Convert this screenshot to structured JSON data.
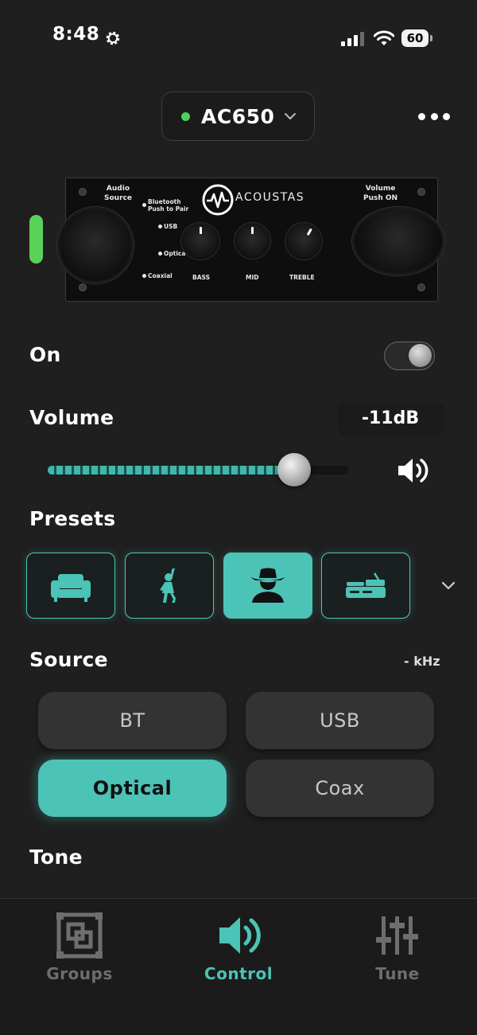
{
  "status_bar": {
    "time": "8:48",
    "battery": "60"
  },
  "header": {
    "device_name": "AC650"
  },
  "panel": {
    "brand": "ACOUSTAS",
    "audio_source_label": "Audio\nSource",
    "volume_label": "Volume\nPush ON",
    "bluetooth_label": "Bluetooth\nPush to Pair",
    "usb_label": "USB",
    "optical_label": "Optical",
    "coaxial_label": "Coaxial",
    "bass_label": "BASS",
    "mid_label": "MID",
    "treble_label": "TREBLE"
  },
  "power": {
    "label": "On",
    "value": true
  },
  "volume": {
    "label": "Volume",
    "readout": "-11dB",
    "level": 0.82
  },
  "presets": {
    "label": "Presets",
    "items": [
      {
        "icon": "couch-icon",
        "active": false
      },
      {
        "icon": "dancer-icon",
        "active": false
      },
      {
        "icon": "cowboy-icon",
        "active": true
      },
      {
        "icon": "turntable-icon",
        "active": false
      }
    ]
  },
  "source": {
    "label": "Source",
    "rate": "- kHz",
    "buttons": [
      {
        "label": "BT",
        "active": false
      },
      {
        "label": "USB",
        "active": false
      },
      {
        "label": "Optical",
        "active": true
      },
      {
        "label": "Coax",
        "active": false
      }
    ]
  },
  "tone": {
    "label": "Tone"
  },
  "nav": {
    "items": [
      {
        "label": "Groups",
        "icon": "groups-icon",
        "active": false
      },
      {
        "label": "Control",
        "icon": "speaker-icon",
        "active": true
      },
      {
        "label": "Tune",
        "icon": "sliders-icon",
        "active": false
      }
    ]
  },
  "colors": {
    "accent": "#4cc3b7",
    "status_green": "#4cd25a",
    "background": "#1f1f1f"
  }
}
